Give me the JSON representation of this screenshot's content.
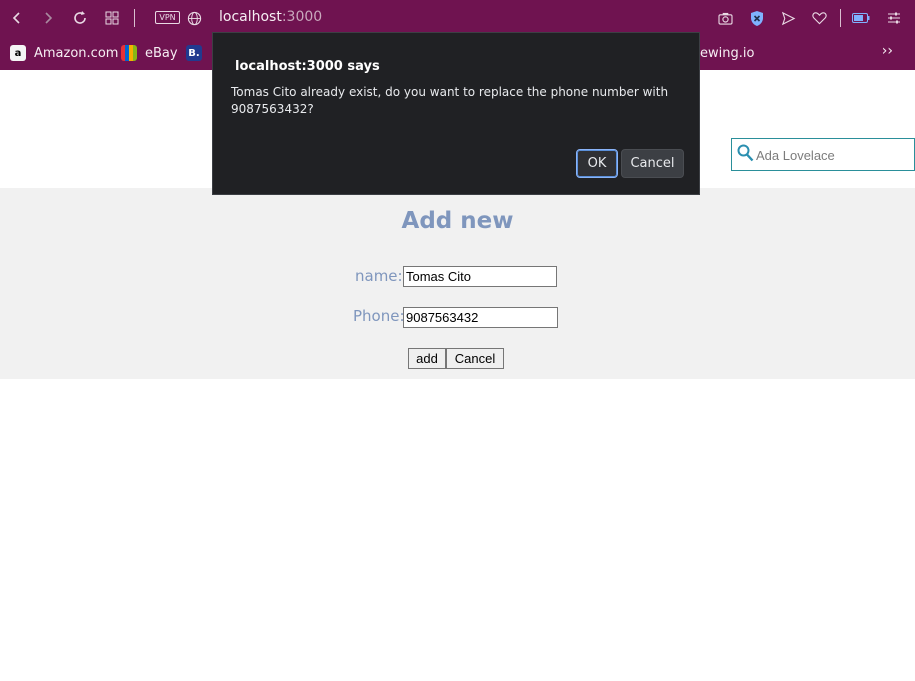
{
  "browser": {
    "url_host": "localhost",
    "url_port": ":3000",
    "vpn_label": "VPN",
    "bookmarks": [
      {
        "label": "Amazon.com",
        "icon": "amazon-icon"
      },
      {
        "label": "eBay",
        "icon": "ebay-icon"
      },
      {
        "label": "B.",
        "icon": "booking-icon"
      },
      {
        "label": "ewing.io",
        "icon": "bookmark-icon"
      }
    ],
    "overflow_label": "››"
  },
  "search": {
    "placeholder": "Ada Lovelace",
    "value": ""
  },
  "form": {
    "heading": "Add new",
    "name_label": "name:",
    "name_value": "Tomas Cito",
    "phone_label": "Phone:",
    "phone_value": "9087563432",
    "add_label": "add",
    "cancel_label": "Cancel"
  },
  "dialog": {
    "title": "localhost:3000 says",
    "message": "Tomas Cito already exist, do you want to replace the phone number with 9087563432?",
    "ok_label": "OK",
    "cancel_label": "Cancel"
  },
  "colors": {
    "chrome": "#6f1350",
    "heading": "#7f96bd",
    "dialog_bg": "#202124",
    "accent": "#8ab4f8"
  }
}
